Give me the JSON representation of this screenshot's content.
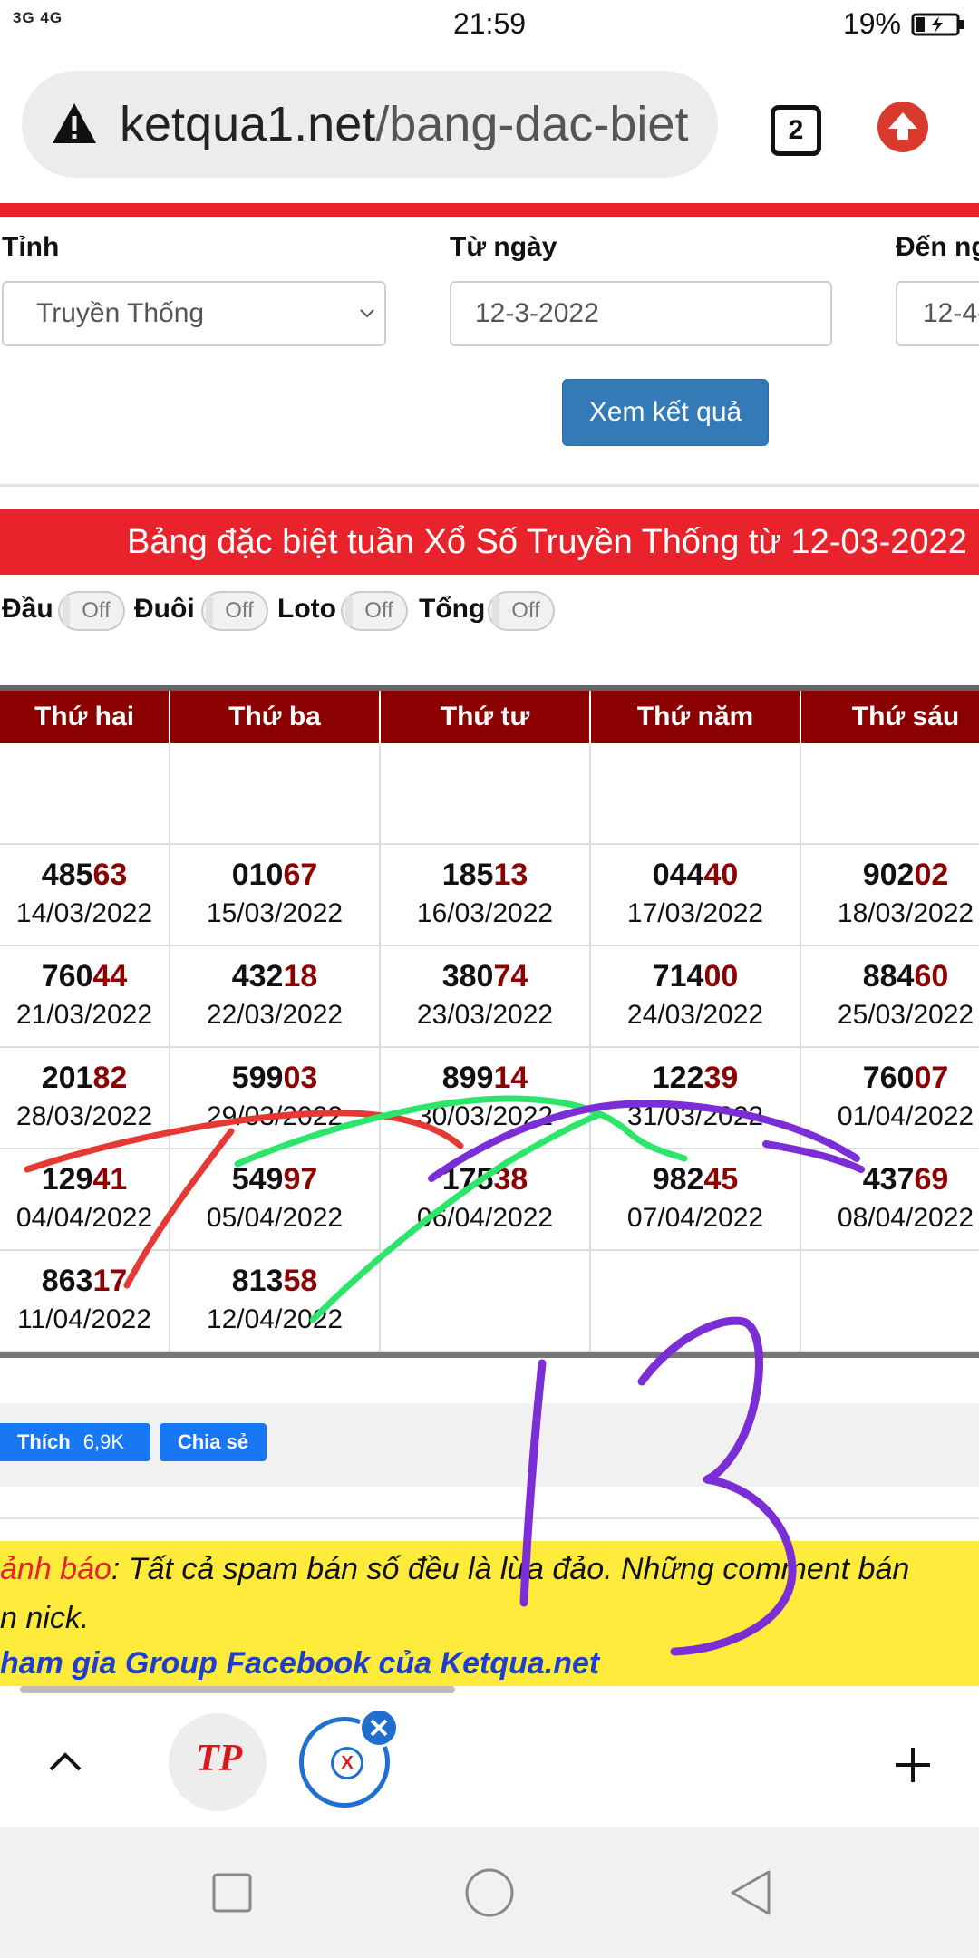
{
  "status_bar": {
    "signal": "3G  4G",
    "time": "21:59",
    "battery": "19%"
  },
  "browser": {
    "url_domain": "ketqua1.net",
    "url_path": "/bang-dac-biet",
    "tab_count": "2"
  },
  "form": {
    "province_label": "Tỉnh",
    "province_value": "Truyền Thống",
    "from_label": "Từ ngày",
    "from_value": "12-3-2022",
    "to_label": "Đến ng",
    "to_value": "12-4-",
    "submit_label": "Xem kết quả"
  },
  "banner": "Bảng đặc biệt tuần Xổ Số Truyền Thống từ 12-03-2022",
  "toggles": [
    {
      "label": "Đầu",
      "state": "Off"
    },
    {
      "label": "Đuôi",
      "state": "Off"
    },
    {
      "label": "Loto",
      "state": "Off"
    },
    {
      "label": "Tổng",
      "state": "Off"
    }
  ],
  "table": {
    "headers": [
      "Thứ hai",
      "Thứ ba",
      "Thứ tư",
      "Thứ năm",
      "Thứ sáu"
    ],
    "rows": [
      [
        {
          "head": "",
          "tail": "",
          "date": ""
        },
        {
          "head": "",
          "tail": "",
          "date": ""
        },
        {
          "head": "",
          "tail": "",
          "date": ""
        },
        {
          "head": "",
          "tail": "",
          "date": ""
        },
        {
          "head": "",
          "tail": "",
          "date": ""
        }
      ],
      [
        {
          "head": "485",
          "tail": "63",
          "date": "14/03/2022"
        },
        {
          "head": "010",
          "tail": "67",
          "date": "15/03/2022"
        },
        {
          "head": "185",
          "tail": "13",
          "date": "16/03/2022"
        },
        {
          "head": "044",
          "tail": "40",
          "date": "17/03/2022"
        },
        {
          "head": "902",
          "tail": "02",
          "date": "18/03/2022"
        }
      ],
      [
        {
          "head": "760",
          "tail": "44",
          "date": "21/03/2022"
        },
        {
          "head": "432",
          "tail": "18",
          "date": "22/03/2022"
        },
        {
          "head": "380",
          "tail": "74",
          "date": "23/03/2022"
        },
        {
          "head": "714",
          "tail": "00",
          "date": "24/03/2022"
        },
        {
          "head": "884",
          "tail": "60",
          "date": "25/03/2022"
        }
      ],
      [
        {
          "head": "201",
          "tail": "82",
          "date": "28/03/2022"
        },
        {
          "head": "599",
          "tail": "03",
          "date": "29/03/2022"
        },
        {
          "head": "899",
          "tail": "14",
          "date": "30/03/2022"
        },
        {
          "head": "122",
          "tail": "39",
          "date": "31/03/2022"
        },
        {
          "head": "760",
          "tail": "07",
          "date": "01/04/2022"
        }
      ],
      [
        {
          "head": "129",
          "tail": "41",
          "date": "04/04/2022"
        },
        {
          "head": "549",
          "tail": "97",
          "date": "05/04/2022"
        },
        {
          "head": "175",
          "tail": "38",
          "date": "06/04/2022"
        },
        {
          "head": "982",
          "tail": "45",
          "date": "07/04/2022"
        },
        {
          "head": "437",
          "tail": "69",
          "date": "08/04/2022"
        }
      ],
      [
        {
          "head": "863",
          "tail": "17",
          "date": "11/04/2022"
        },
        {
          "head": "813",
          "tail": "58",
          "date": "12/04/2022"
        },
        {
          "head": "",
          "tail": "",
          "date": ""
        },
        {
          "head": "",
          "tail": "",
          "date": ""
        },
        {
          "head": "",
          "tail": "",
          "date": ""
        }
      ]
    ]
  },
  "social": {
    "like_label": "Thích",
    "like_count": "6,9K",
    "share_label": "Chia sẻ"
  },
  "notice": {
    "warn_word": "ảnh báo",
    "line1_rest": ": Tất cả spam bán số đều là lừa đảo. Những comment bán",
    "line2": "n nick.",
    "line3": "ham gia Group Facebook của Ketqua.net"
  },
  "annotation": {
    "text": "13",
    "colors": [
      "#e53935",
      "#2ee56b",
      "#7b2ed6"
    ]
  },
  "bottom_tabs": {
    "tab1": "TP",
    "tab2": "X"
  }
}
